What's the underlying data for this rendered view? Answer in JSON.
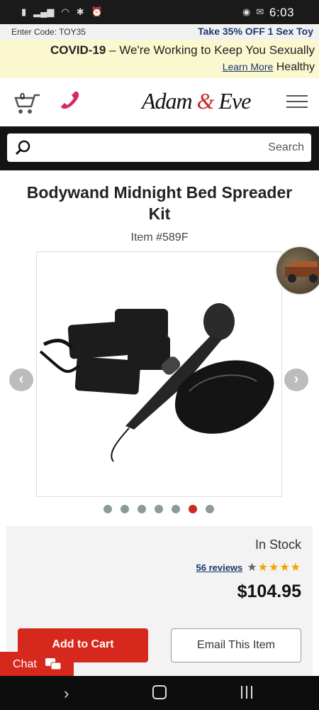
{
  "status_bar": {
    "time": "6:03"
  },
  "promo": {
    "offer": "Take 35% OFF 1 Sex Toy",
    "code": "Enter Code: TOY35"
  },
  "covid": {
    "label": "COVID-19",
    "message": " – We're Working to Keep You Sexually",
    "message2": "Healthy",
    "learn_more": "Learn More"
  },
  "header": {
    "cart_count": "0",
    "logo_a": "Adam ",
    "logo_amp": "&",
    "logo_b": " Eve"
  },
  "search": {
    "placeholder": "Search"
  },
  "product": {
    "title": "Bodywand Midnight Bed Spreader Kit",
    "item_number": "Item #589F",
    "image_count": 7,
    "active_image": 6
  },
  "buy": {
    "stock": "In Stock",
    "rating": 4,
    "rating_max": 5,
    "reviews": "56 reviews",
    "price": "$104.95",
    "email_label": "Email This Item",
    "cart_label": "Add to Cart"
  },
  "chat": {
    "label": "Chat"
  },
  "colors": {
    "accent": "#d6281c",
    "navy": "#1b3a6b",
    "covid_bg": "#fbf7cf"
  }
}
